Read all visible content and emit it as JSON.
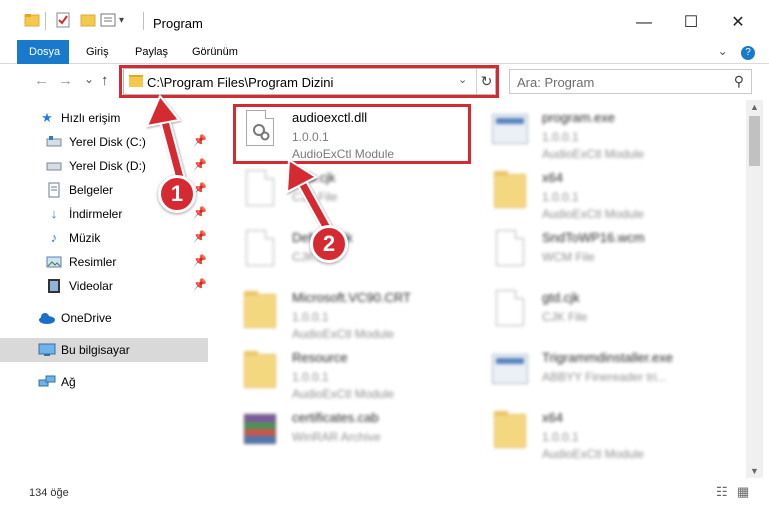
{
  "window": {
    "title": "Program",
    "minimize_glyph": "—",
    "maximize_glyph": "☐",
    "close_glyph": "✕"
  },
  "ribbon": {
    "tabs": [
      {
        "label": "Dosya",
        "active": true
      },
      {
        "label": "Giriş",
        "active": false
      },
      {
        "label": "Paylaş",
        "active": false
      },
      {
        "label": "Görünüm",
        "active": false
      }
    ],
    "expand_icon": "chevron-down-icon",
    "help_icon": "help-icon"
  },
  "nav": {
    "back_glyph": "←",
    "forward_glyph": "→",
    "recent_glyph": "⌄",
    "up_glyph": "↑",
    "address": "C:\\Program Files\\Program Dizini",
    "address_dropdown_glyph": "⌄",
    "refresh_glyph": "↻",
    "search_placeholder": "Ara: Program",
    "search_glyph": "⚲"
  },
  "sidebar": {
    "items": [
      {
        "label": "Hızlı erişim",
        "icon": "star-icon",
        "pinned": false
      },
      {
        "label": "Yerel Disk (C:)",
        "icon": "drive-icon",
        "pinned": true
      },
      {
        "label": "Yerel Disk (D:)",
        "icon": "drive-icon",
        "pinned": true
      },
      {
        "label": "Belgeler",
        "icon": "documents-icon",
        "pinned": true
      },
      {
        "label": "İndirmeler",
        "icon": "download-icon",
        "pinned": true
      },
      {
        "label": "Müzik",
        "icon": "music-icon",
        "pinned": true
      },
      {
        "label": "Resimler",
        "icon": "pictures-icon",
        "pinned": true
      },
      {
        "label": "Videolar",
        "icon": "videos-icon",
        "pinned": true
      },
      {
        "label": "OneDrive",
        "icon": "cloud-icon",
        "pinned": false
      },
      {
        "label": "Bu bilgisayar",
        "icon": "computer-icon",
        "pinned": false,
        "selected": true
      },
      {
        "label": "Ağ",
        "icon": "network-icon",
        "pinned": false
      }
    ],
    "pin_glyph": "📌"
  },
  "files": [
    {
      "name": "audioexctl.dll",
      "version": "1.0.0.1",
      "description": "AudioExCtl Module",
      "icon": "dll-file-icon",
      "highlighted": true
    },
    {
      "name": "program.exe",
      "version": "1.0.0.1",
      "description": "AudioExCtl Module",
      "icon": "exe-file-icon"
    },
    {
      "name": "Deb.cjk",
      "version": "",
      "description": "CJK File",
      "icon": "file-icon"
    },
    {
      "name": "x64",
      "version": "1.0.0.1",
      "description": "AudioExCtl Module",
      "icon": "folder-icon"
    },
    {
      "name": "Default.cjk",
      "version": "",
      "description": "CJK File",
      "icon": "file-icon"
    },
    {
      "name": "SndToWP16.wcm",
      "version": "",
      "description": "WCM File",
      "icon": "file-icon"
    },
    {
      "name": "Microsoft.VC90.CRT",
      "version": "1.0.0.1",
      "description": "AudioExCtl Module",
      "icon": "folder-icon"
    },
    {
      "name": "gtd.cjk",
      "version": "",
      "description": "CJK File",
      "icon": "file-icon"
    },
    {
      "name": "Resource",
      "version": "1.0.0.1",
      "description": "AudioExCtl Module",
      "icon": "folder-icon"
    },
    {
      "name": "Trigrammdinstaller.exe",
      "version": "",
      "description": "ABBYY Finereader tri...",
      "icon": "exe-file-icon"
    },
    {
      "name": "certificates.cab",
      "version": "",
      "description": "WinRAR Archive",
      "icon": "archive-icon"
    },
    {
      "name": "x64",
      "version": "1.0.0.1",
      "description": "AudioExCtl Module",
      "icon": "folder-icon"
    }
  ],
  "annotations": {
    "badge_1": "1",
    "badge_2": "2",
    "color": "#d62a33"
  },
  "status": {
    "item_count": "134 öğe",
    "details_view_icon": "details-view-icon",
    "tiles_view_icon": "tiles-view-icon"
  },
  "colors": {
    "accent": "#1979ca",
    "highlight": "#d62a33",
    "selected_bg": "#d9d9d9"
  }
}
